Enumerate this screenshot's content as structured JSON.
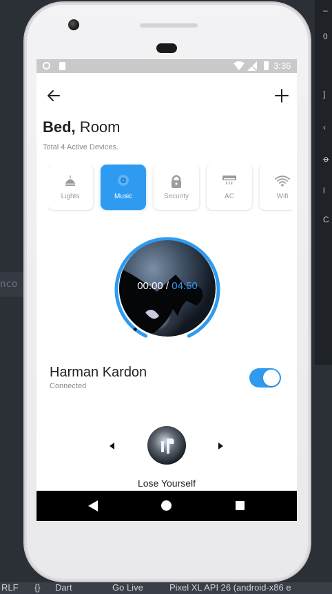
{
  "ide": {
    "left_fragment": "nco",
    "right_panel_glyphs": [
      "–",
      "0",
      "]",
      "‹",
      "ꝋ",
      "l",
      "C"
    ],
    "status": {
      "line_ending": "RLF",
      "braces": "{}",
      "language": "Dart",
      "go_live": "Go Live",
      "device": "Pixel XL API 26 (android-x86 e"
    }
  },
  "statusbar": {
    "time": "3:36"
  },
  "header": {
    "title_bold": "Bed,",
    "title_rest": " Room",
    "subtitle": "Total 4 Active Devices."
  },
  "devices": [
    {
      "label": "Lights",
      "icon": "lamp-icon",
      "active": false
    },
    {
      "label": "Music",
      "icon": "speaker-icon",
      "active": true
    },
    {
      "label": "Security",
      "icon": "lock-icon",
      "active": false
    },
    {
      "label": "AC",
      "icon": "air-conditioner-icon",
      "active": false
    },
    {
      "label": "Wifi",
      "icon": "wifi-icon",
      "active": false
    }
  ],
  "player": {
    "elapsed": "00:00",
    "separator": " / ",
    "total": "04:50",
    "progress": 0.02,
    "ring_color": "#2f9bf0"
  },
  "speaker": {
    "name": "Harman Kardon",
    "status": "Connected",
    "enabled": true
  },
  "track": {
    "title": "Lose Yourself"
  },
  "colors": {
    "accent": "#2f9bf0",
    "text": "#222222",
    "muted": "#8a8a8a"
  }
}
